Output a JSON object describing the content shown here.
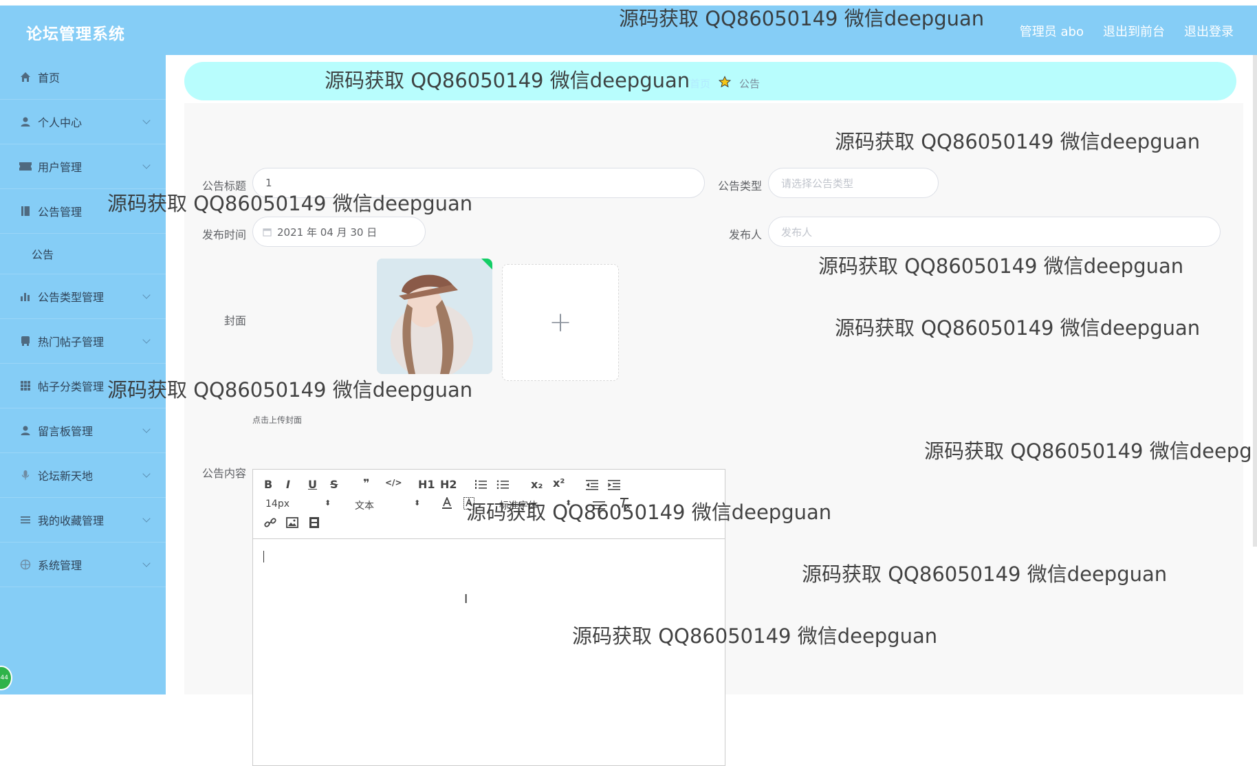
{
  "header": {
    "title": "论坛管理系统",
    "admin_label": "管理员 abo",
    "back_to_front": "退出到前台",
    "logout": "退出登录",
    "bg_color": "#85cdf6"
  },
  "sidebar": {
    "items": [
      {
        "label": "首页",
        "icon": "home-icon"
      },
      {
        "label": "个人中心",
        "icon": "user-icon"
      },
      {
        "label": "用户管理",
        "icon": "ticket-icon"
      },
      {
        "label": "公告管理",
        "icon": "book-icon"
      },
      {
        "label": "公告",
        "icon": ""
      },
      {
        "label": "公告类型管理",
        "icon": "bar-chart-icon"
      },
      {
        "label": "热门帖子管理",
        "icon": "bus-icon"
      },
      {
        "label": "帖子分类管理",
        "icon": "grid-icon"
      },
      {
        "label": "留言板管理",
        "icon": "person-icon"
      },
      {
        "label": "论坛新天地",
        "icon": "microphone-icon"
      },
      {
        "label": "我的收藏管理",
        "icon": "list-icon"
      },
      {
        "label": "系统管理",
        "icon": "globe-icon"
      }
    ],
    "float_badge": "44"
  },
  "breadcrumb": {
    "home": "首页",
    "current": "公告"
  },
  "form": {
    "title_label": "公告标题",
    "title_value": "1",
    "type_label": "公告类型",
    "type_placeholder": "请选择公告类型",
    "time_label": "发布时间",
    "time_value": "2021 年 04 月 30 日",
    "publisher_label": "发布人",
    "publisher_placeholder": "发布人",
    "cover_label": "封面",
    "cover_tip": "点击上传封面",
    "add_symbol": "+",
    "content_label": "公告内容"
  },
  "editor": {
    "font_size": "14px",
    "block_type": "文本",
    "font_family": "标准字体",
    "buttons": [
      "B",
      "I",
      "U",
      "S",
      "❞",
      "</>",
      "H1",
      "H2",
      "ordered-list",
      "bullet-list",
      "x₂",
      "x²",
      "outdent",
      "indent"
    ]
  },
  "watermark": "源码获取 QQ86050149 微信deepguan",
  "watermark_partial": "源码获取 QQ86050149 微信deepg"
}
